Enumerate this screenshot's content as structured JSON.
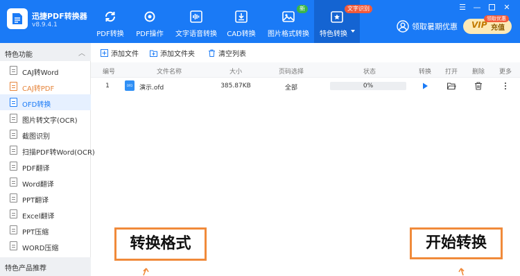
{
  "app": {
    "name": "迅捷PDF转换器",
    "version": "v8.9.4.1"
  },
  "nav": [
    {
      "label": "PDF转换",
      "icon": "refresh-icon"
    },
    {
      "label": "PDF操作",
      "icon": "settings-icon"
    },
    {
      "label": "文字语音转换",
      "icon": "audio-wave-icon"
    },
    {
      "label": "CAD转换",
      "icon": "cad-import-icon"
    },
    {
      "label": "图片格式转换",
      "icon": "image-icon",
      "badge": "新"
    },
    {
      "label": "特色转换",
      "icon": "star-box-icon",
      "badge": "文字识别",
      "active": true
    }
  ],
  "header": {
    "user_label": "领取暑期优惠",
    "vip_text": "VIP",
    "vip_label": "充值",
    "vip_badge": "领取优惠"
  },
  "sidebar": {
    "section_title": "特色功能",
    "items": [
      {
        "label": "CAJ转Word",
        "state": "normal"
      },
      {
        "label": "CAJ转PDF",
        "state": "orange"
      },
      {
        "label": "OFD转换",
        "state": "active"
      },
      {
        "label": "图片转文字(OCR)",
        "state": "normal"
      },
      {
        "label": "截图识别",
        "state": "normal"
      },
      {
        "label": "扫描PDF转Word(OCR)",
        "state": "normal"
      },
      {
        "label": "PDF翻译",
        "state": "normal"
      },
      {
        "label": "Word翻译",
        "state": "normal"
      },
      {
        "label": "PPT翻译",
        "state": "normal"
      },
      {
        "label": "Excel翻译",
        "state": "normal"
      },
      {
        "label": "PPT压缩",
        "state": "normal"
      },
      {
        "label": "WORD压缩",
        "state": "normal"
      }
    ],
    "footer_title": "特色产品推荐"
  },
  "toolbar": {
    "add_file": "添加文件",
    "add_folder": "添加文件夹",
    "clear_list": "清空列表"
  },
  "table": {
    "headers": [
      "编号",
      "文件名称",
      "大小",
      "页码选择",
      "状态",
      "转换",
      "打开",
      "删除",
      "更多"
    ],
    "rows": [
      {
        "index": "1",
        "file_icon_text": "OFD",
        "name": "演示.ofd",
        "size": "385.87KB",
        "pages": "全部",
        "progress_text": "0%",
        "progress": 0
      }
    ]
  },
  "annotations": {
    "left": "转换格式",
    "right": "开始转换"
  },
  "colors": {
    "brand": "#1a7af6",
    "accent_orange": "#e6843a",
    "annotation_border": "#f08a3a"
  }
}
